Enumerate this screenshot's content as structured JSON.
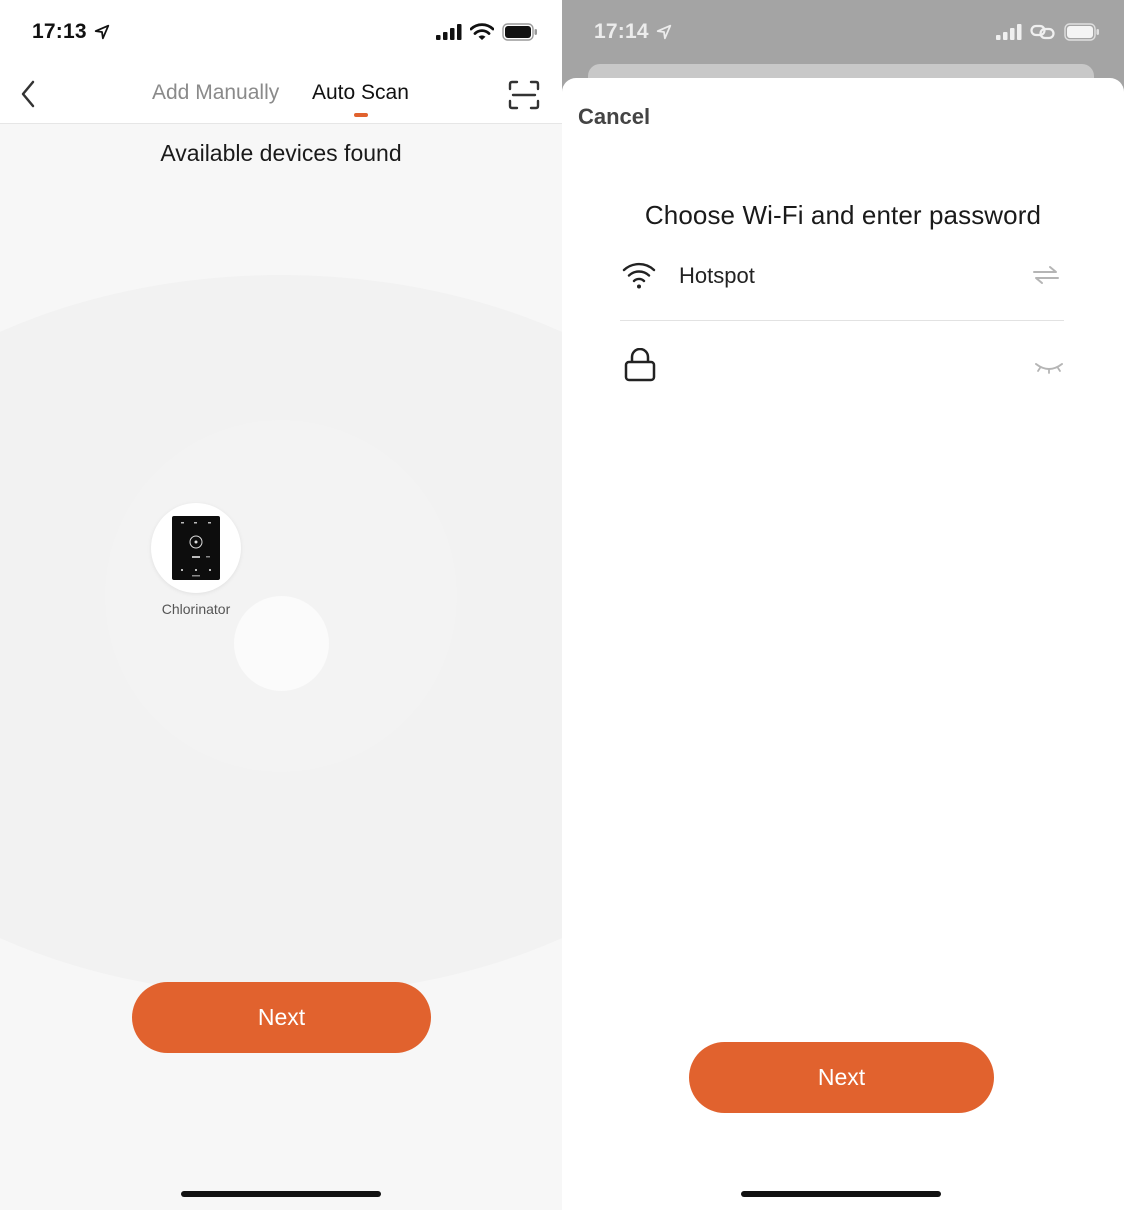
{
  "left": {
    "status": {
      "time": "17:13"
    },
    "nav": {
      "tabs": [
        {
          "label": "Add Manually",
          "active": false
        },
        {
          "label": "Auto Scan",
          "active": true
        }
      ]
    },
    "title": "Available devices found",
    "device": {
      "name": "Chlorinator"
    },
    "next_label": "Next"
  },
  "right": {
    "status": {
      "time": "17:14"
    },
    "cancel_label": "Cancel",
    "title": "Choose Wi-Fi and enter password",
    "wifi": {
      "ssid": "Hotspot"
    },
    "password": {
      "value": ""
    },
    "next_label": "Next"
  },
  "colors": {
    "accent": "#e1622e",
    "text_primary": "#1a1a1a",
    "text_secondary": "#8a8a8a",
    "background_left": "#f7f7f7",
    "overlay": "#a4a4a4"
  },
  "icons": {
    "location": "location-arrow-icon",
    "signal": "cellular-signal-icon",
    "wifi_status": "wifi-icon",
    "hotspot": "hotspot-link-icon",
    "battery": "battery-icon",
    "back": "chevron-left-icon",
    "scan": "scan-frame-icon",
    "wifi_network": "wifi-icon",
    "switch_network": "switch-arrows-icon",
    "lock": "lock-icon",
    "visibility": "eye-closed-icon"
  }
}
